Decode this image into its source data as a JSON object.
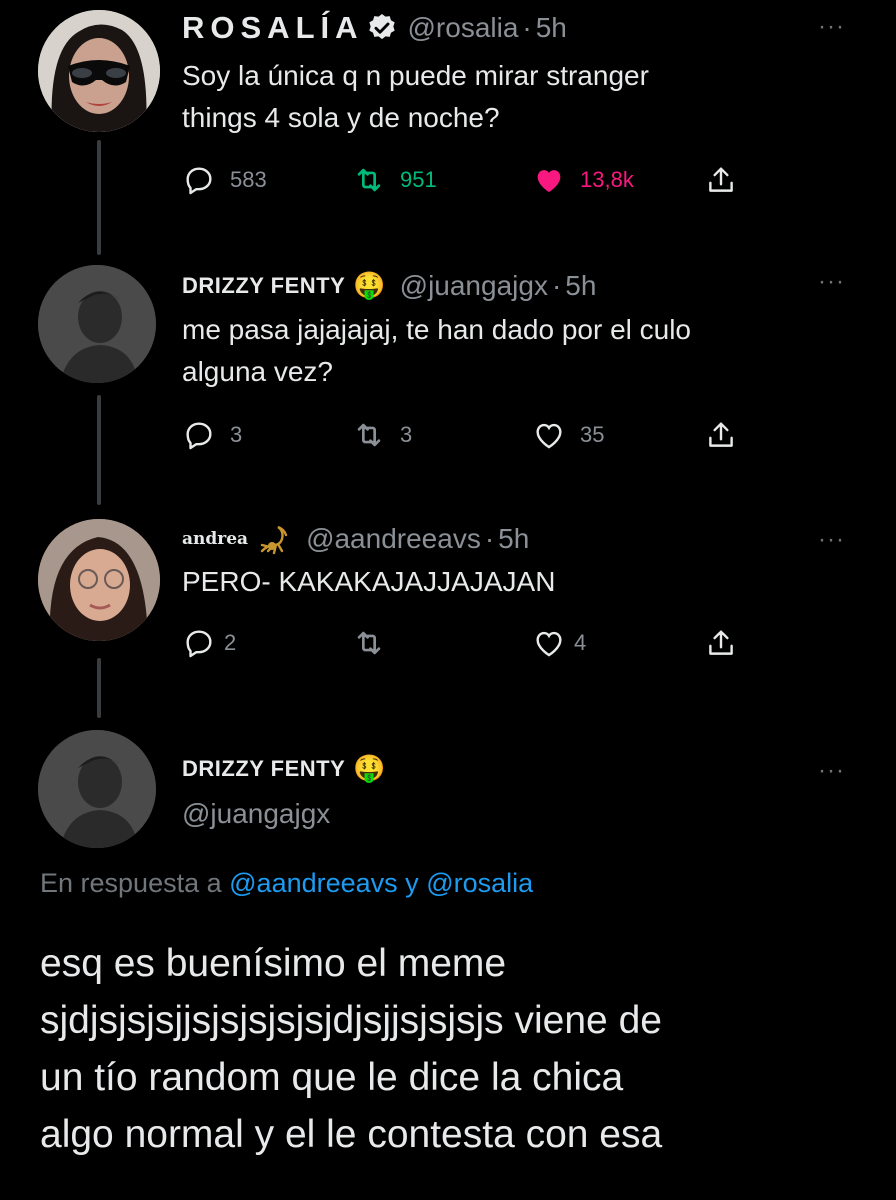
{
  "tweets": [
    {
      "name": "ROSALÍA",
      "handle": "@rosalia",
      "time": "5h",
      "text_lines": [
        "Soy la única q n puede mirar stranger",
        "things 4 sola y de noche?"
      ],
      "replies": "583",
      "retweets": "951",
      "likes": "13,8k",
      "verified_icon": "verified-badge-icon",
      "retweet_color": "#00ba7c",
      "like_color": "#f91880"
    },
    {
      "name": "DRIZZY FENTY",
      "emoji": "🤑",
      "handle": "@juangajgx",
      "time": "5h",
      "text_lines": [
        "me pasa jajajajaj, te han dado por el culo",
        "alguna vez?"
      ],
      "replies": "3",
      "retweets": "3",
      "likes": "35"
    },
    {
      "name": "andrea",
      "emoji_icon": "scorpion-icon",
      "handle": "@aandreeavs",
      "time": "5h",
      "text_lines": [
        "PERO- KAKAKAJAJJAJAJAN"
      ],
      "replies": "2",
      "retweets": "",
      "likes": "4"
    }
  ],
  "focused": {
    "name": "DRIZZY FENTY",
    "emoji": "🤑",
    "handle": "@juangajgx",
    "reply_prefix": "En respuesta a",
    "mention_1": "@aandreeavs",
    "connector": "y",
    "mention_2": "@rosalia",
    "text_lines": [
      "esq es buenísimo el meme",
      "sjdjsjsjsjjsjsjsjsjsjdjsjjsjsjsjs viene de",
      "un tío random que le dice la chica",
      "algo normal y el le contesta con esa"
    ]
  },
  "more_icon": "more-dots-icon",
  "mention_color": "#1d9bf0"
}
